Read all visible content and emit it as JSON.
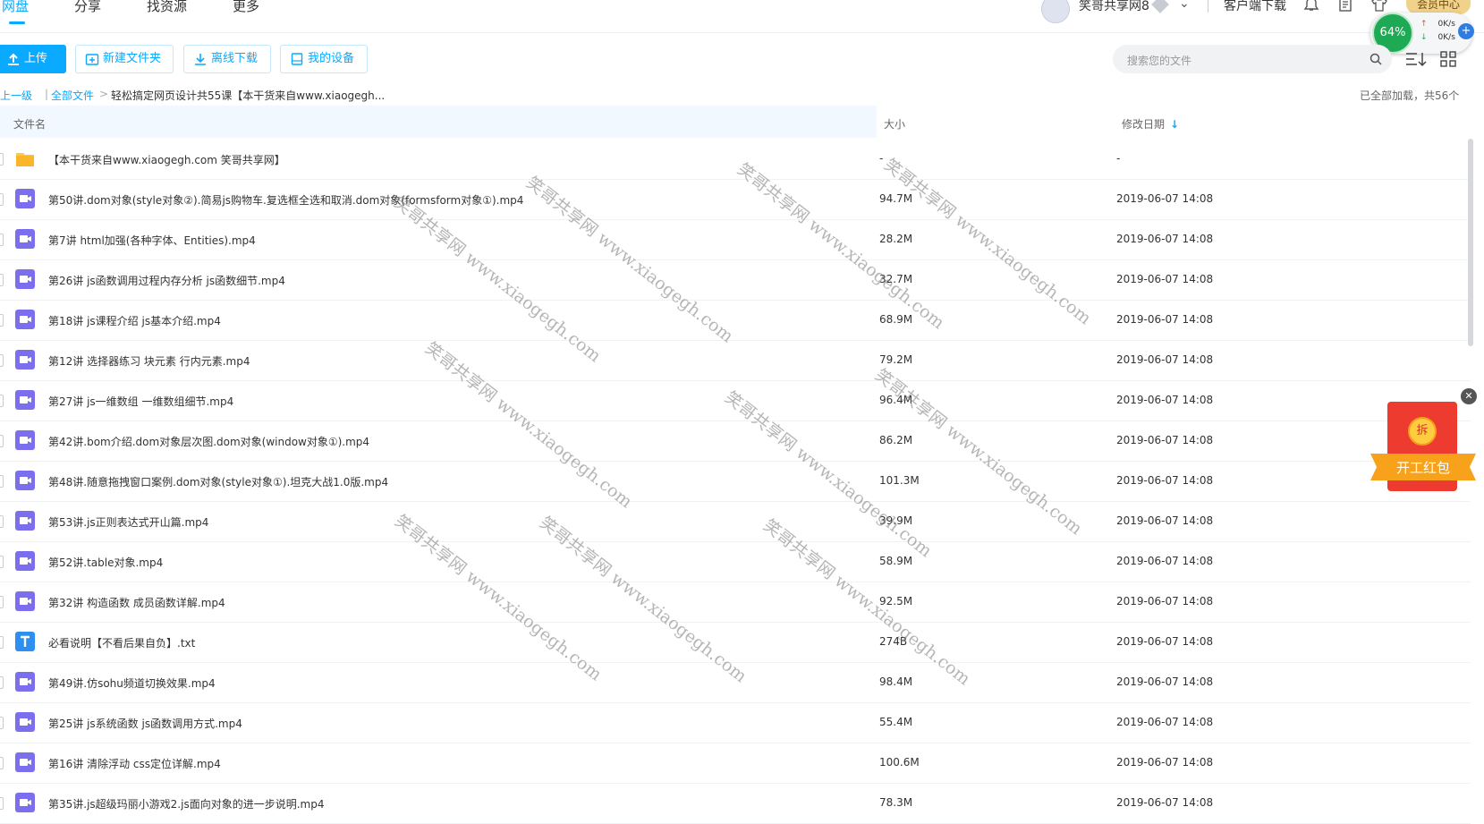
{
  "topnav": {
    "tabs": [
      {
        "label": "网盘",
        "active": true
      },
      {
        "label": "分享",
        "active": false
      },
      {
        "label": "找资源",
        "active": false
      },
      {
        "label": "更多",
        "active": false
      }
    ],
    "user_name": "笑哥共享网8",
    "client_download": "客户端下载",
    "member_center": "会员中心",
    "accent_color": "#09aaff"
  },
  "speed_widget": {
    "percent": "64%",
    "upload": "0K/s",
    "download": "0K/s"
  },
  "toolbar": {
    "upload_label": "上传",
    "new_folder_label": "新建文件夹",
    "offline_download_label": "离线下载",
    "my_devices_label": "我的设备",
    "search_placeholder": "搜索您的文件"
  },
  "breadcrumb": {
    "up_level": "返回上一级",
    "all_files": "全部文件",
    "separator": "|",
    "arrow": ">",
    "current": "轻松搞定网页设计共55课【本干货来自www.xiaogegh..."
  },
  "load_status": "已全部加载，共56个",
  "table": {
    "columns": {
      "name": "文件名",
      "size": "大小",
      "date": "修改日期"
    },
    "rows": [
      {
        "type": "folder",
        "name": "【本干货来自www.xiaogegh.com 笑哥共享网】",
        "size": "-",
        "date": "-"
      },
      {
        "type": "video",
        "name": "第50讲.dom对象(style对象②).简易js购物车.复选框全选和取消.dom对象(formsform对象①).mp4",
        "size": "94.7M",
        "date": "2019-06-07 14:08"
      },
      {
        "type": "video",
        "name": "第7讲 html加强(各种字体、Entities).mp4",
        "size": "28.2M",
        "date": "2019-06-07 14:08"
      },
      {
        "type": "video",
        "name": "第26讲 js函数调用过程内存分析 js函数细节.mp4",
        "size": "32.7M",
        "date": "2019-06-07 14:08"
      },
      {
        "type": "video",
        "name": "第18讲 js课程介绍 js基本介绍.mp4",
        "size": "68.9M",
        "date": "2019-06-07 14:08"
      },
      {
        "type": "video",
        "name": "第12讲 选择器练习 块元素 行内元素.mp4",
        "size": "79.2M",
        "date": "2019-06-07 14:08"
      },
      {
        "type": "video",
        "name": "第27讲 js一维数组 一维数组细节.mp4",
        "size": "96.4M",
        "date": "2019-06-07 14:08"
      },
      {
        "type": "video",
        "name": "第42讲.bom介绍.dom对象层次图.dom对象(window对象①).mp4",
        "size": "86.2M",
        "date": "2019-06-07 14:08"
      },
      {
        "type": "video",
        "name": "第48讲.随意拖拽窗口案例.dom对象(style对象①).坦克大战1.0版.mp4",
        "size": "101.3M",
        "date": "2019-06-07 14:08"
      },
      {
        "type": "video",
        "name": "第53讲.js正则表达式开山篇.mp4",
        "size": "39.9M",
        "date": "2019-06-07 14:08"
      },
      {
        "type": "video",
        "name": "第52讲.table对象.mp4",
        "size": "58.9M",
        "date": "2019-06-07 14:08"
      },
      {
        "type": "video",
        "name": "第32讲 构造函数 成员函数详解.mp4",
        "size": "92.5M",
        "date": "2019-06-07 14:08"
      },
      {
        "type": "text",
        "name": "必看说明【不看后果自负】.txt",
        "size": "274B",
        "date": "2019-06-07 14:08"
      },
      {
        "type": "video",
        "name": "第49讲.仿sohu频道切换效果.mp4",
        "size": "98.4M",
        "date": "2019-06-07 14:08"
      },
      {
        "type": "video",
        "name": "第25讲 js系统函数 js函数调用方式.mp4",
        "size": "55.4M",
        "date": "2019-06-07 14:08"
      },
      {
        "type": "video",
        "name": "第16讲 清除浮动 css定位详解.mp4",
        "size": "100.6M",
        "date": "2019-06-07 14:08"
      },
      {
        "type": "video",
        "name": "第35讲.js超级玛丽小游戏2.js面向对象的进一步说明.mp4",
        "size": "78.3M",
        "date": "2019-06-07 14:08"
      }
    ]
  },
  "red_packet": {
    "coin_label": "拆",
    "ribbon_label": "开工红包",
    "close_label": "✕"
  },
  "watermark_text": "笑哥共享网 www.xiaogegh.com"
}
